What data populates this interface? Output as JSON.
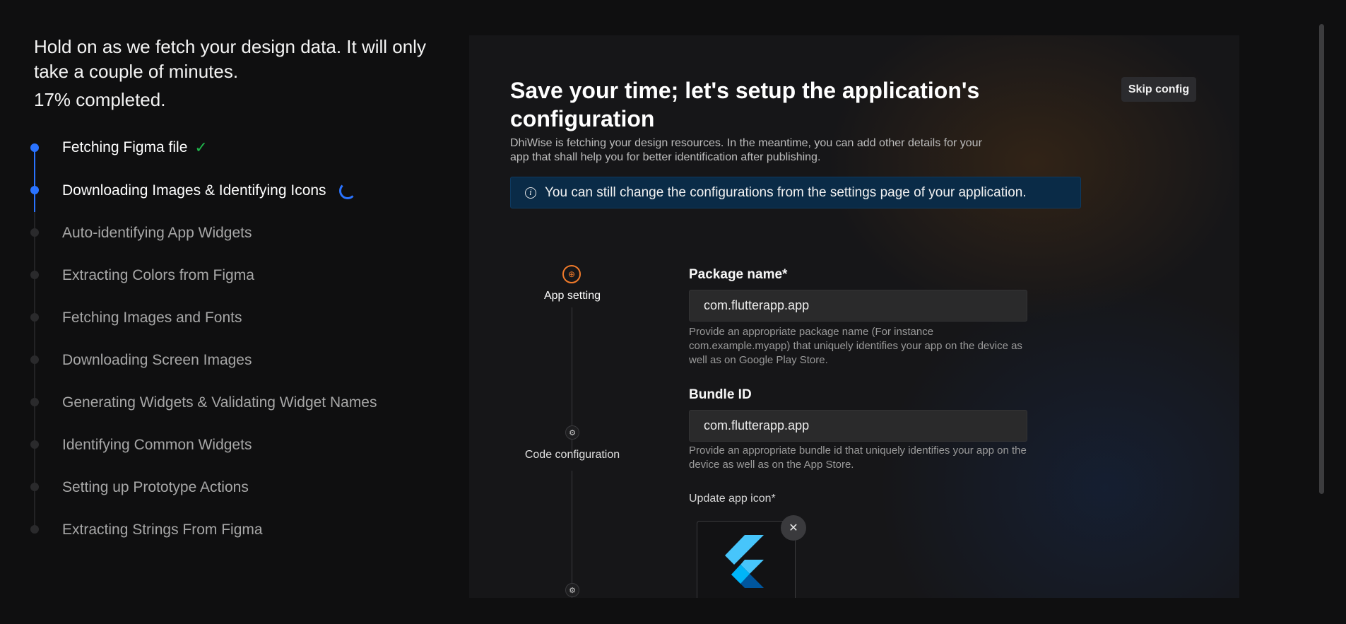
{
  "progress": {
    "headline": "Hold on as we fetch your design data. It will only take a couple of minutes.",
    "percent_text": "17% completed.",
    "steps": [
      {
        "label": "Fetching Figma file",
        "status": "done"
      },
      {
        "label": "Downloading Images & Identifying Icons",
        "status": "in-progress"
      },
      {
        "label": "Auto-identifying App Widgets",
        "status": "pending"
      },
      {
        "label": "Extracting Colors from Figma",
        "status": "pending"
      },
      {
        "label": "Fetching Images and Fonts",
        "status": "pending"
      },
      {
        "label": "Downloading Screen Images",
        "status": "pending"
      },
      {
        "label": "Generating Widgets & Validating Widget Names",
        "status": "pending"
      },
      {
        "label": "Identifying Common Widgets",
        "status": "pending"
      },
      {
        "label": "Setting up Prototype Actions",
        "status": "pending"
      },
      {
        "label": "Extracting Strings From Figma",
        "status": "pending"
      }
    ],
    "check_glyph": "✓",
    "accent_color": "#2a73ff",
    "done_color": "#1fb34a"
  },
  "config": {
    "title": "Save your time; let's setup the application's configuration",
    "skip_label": "Skip config",
    "subtitle": "DhiWise is fetching your design resources. In the meantime, you can add other details for your app that shall help you for better identification after publishing.",
    "info_message": "You can still change the configurations from the settings page of your application.",
    "info_icon": "i",
    "timeline": [
      {
        "label": "App setting",
        "icon": "target-icon",
        "glyph": "⊕"
      },
      {
        "label": "Code configuration",
        "icon": "gear-icon",
        "glyph": "⚙"
      },
      {
        "label": "",
        "icon": "gear-icon",
        "glyph": "⚙"
      }
    ],
    "package": {
      "label": "Package name*",
      "value": "com.flutterapp.app",
      "help": "Provide an appropriate package name (For instance com.example.myapp) that uniquely identifies your app on the device as well as on Google Play Store."
    },
    "bundle": {
      "label": "Bundle ID",
      "value": "com.flutterapp.app",
      "help": "Provide an appropriate bundle id that uniquely identifies your app on the device as well as on the App Store."
    },
    "app_icon": {
      "label": "Update app icon*",
      "icon": "flutter-logo",
      "remove_glyph": "✕"
    }
  }
}
